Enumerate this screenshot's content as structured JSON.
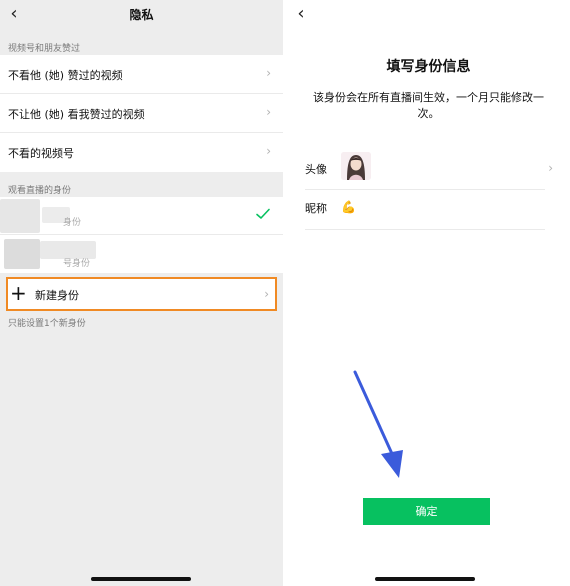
{
  "left": {
    "title": "隐私",
    "section1_label": "视频号和朋友赞过",
    "section1_items": [
      {
        "label": "不看他 (她) 赞过的视频"
      },
      {
        "label": "不让他 (她) 看我赞过的视频"
      },
      {
        "label": "不看的视频号"
      }
    ],
    "section2_label": "观看直播的身份",
    "identities": [
      {
        "label": "身份"
      },
      {
        "label": "号身份"
      }
    ],
    "new_identity_label": "新建身份",
    "note": "只能设置1个新身份"
  },
  "right": {
    "title": "填写身份信息",
    "description": "该身份会在所有直播间生效，一个月只能修改一次。",
    "avatar_label": "头像",
    "nickname_label": "昵称",
    "nickname_emoji": "💪",
    "confirm_label": "确定"
  },
  "colors": {
    "accent_green": "#07c160",
    "highlight_orange": "#f08a24",
    "annotation_arrow": "#3b5bdb"
  }
}
